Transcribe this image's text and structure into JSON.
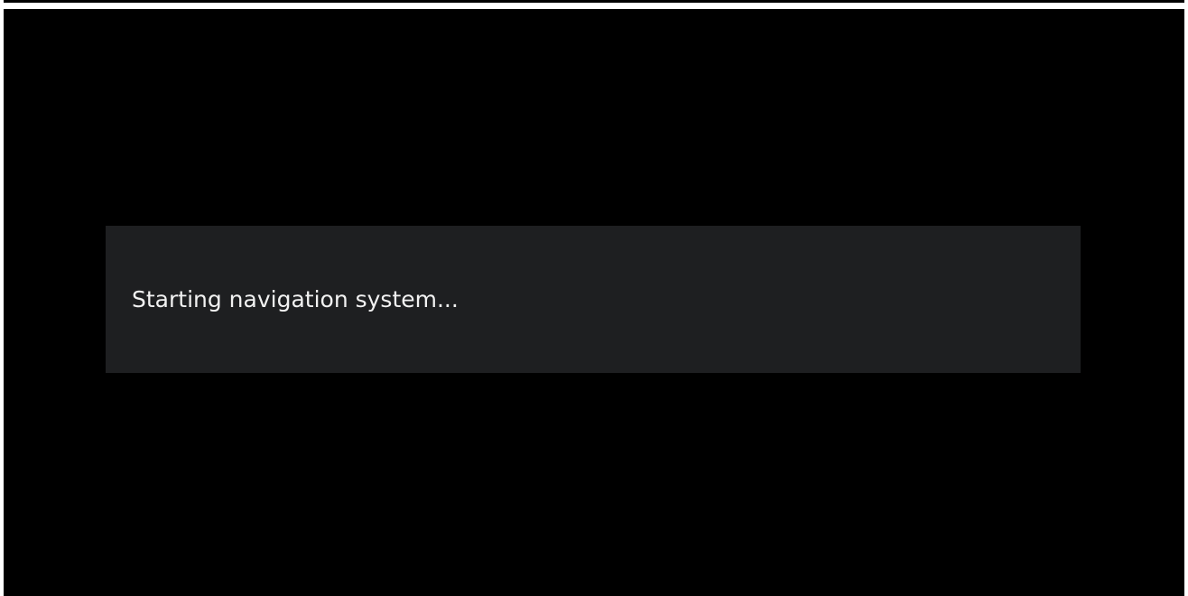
{
  "dialog": {
    "message": "Starting navigation system..."
  },
  "colors": {
    "screen_background": "#000000",
    "dialog_background": "#1e1f21",
    "text": "#f2f2f2"
  }
}
